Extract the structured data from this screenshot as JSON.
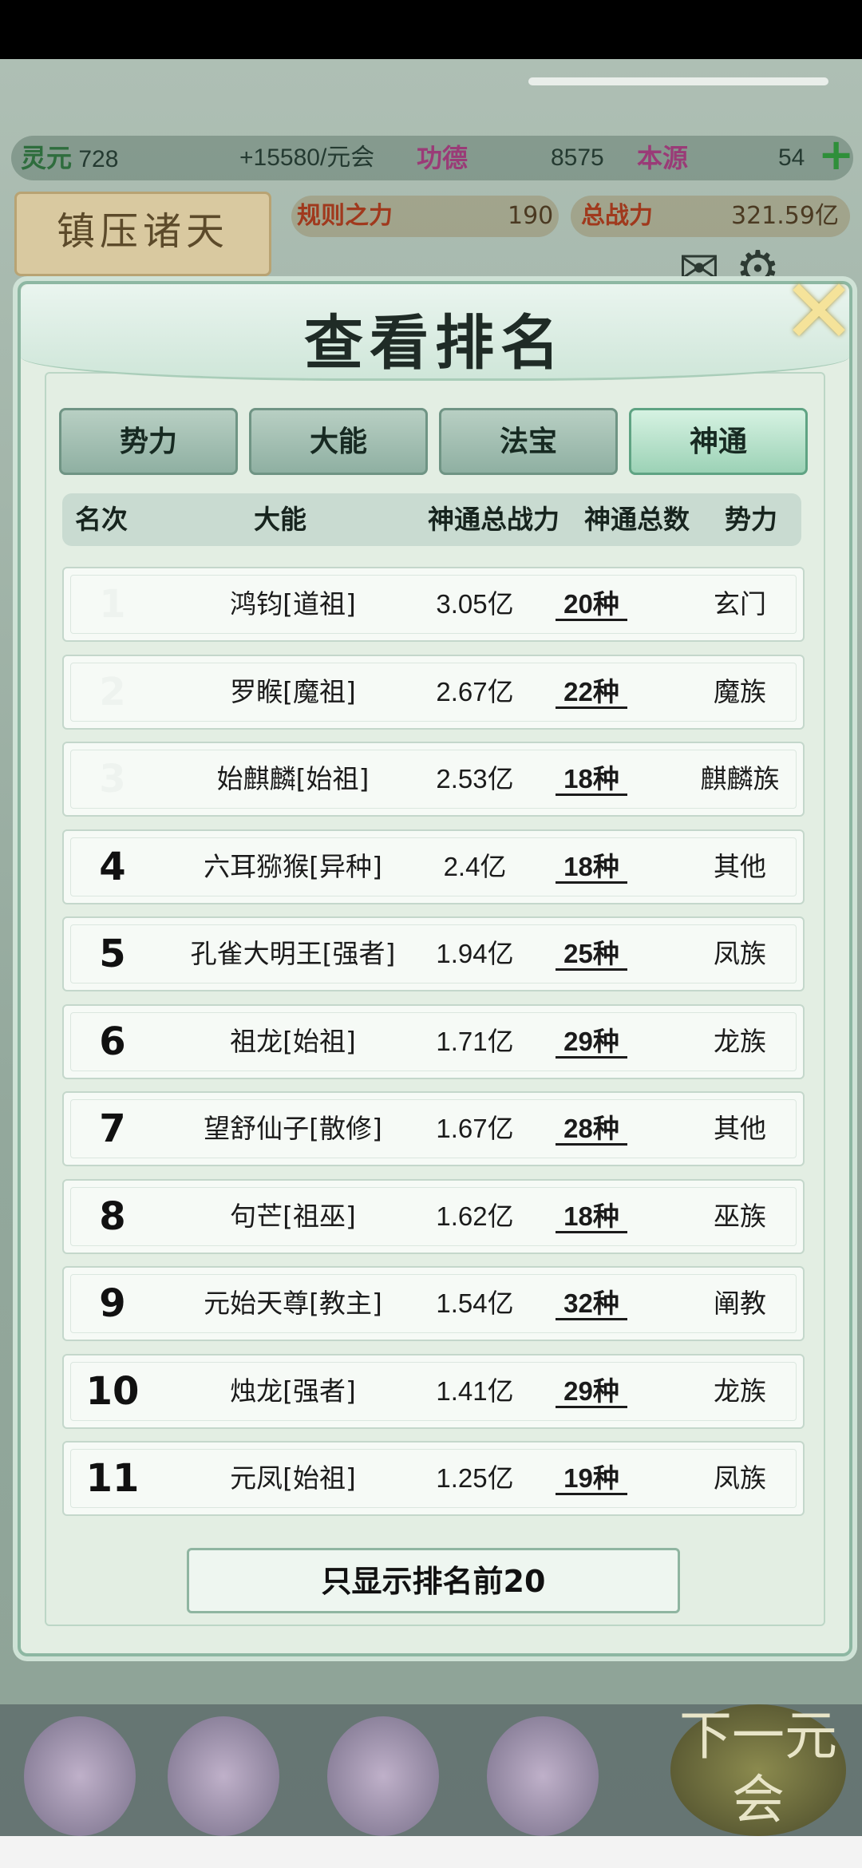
{
  "resources": {
    "lingyuan_label": "灵元",
    "lingyuan_value": "728",
    "lingyuan_rate": "+15580/元会",
    "gongde_label": "功德",
    "gongde_value": "8575",
    "benyuan_label": "本源",
    "benyuan_value": "54",
    "guize_label": "规则之力",
    "guize_value": "190",
    "zongzhan_label": "总战力",
    "zongzhan_value": "321.59亿",
    "zhenya_label": "镇压诸天"
  },
  "modal": {
    "title": "查看排名",
    "close": "✕",
    "tabs": [
      "势力",
      "大能",
      "法宝",
      "神通"
    ],
    "active_tab": "神通",
    "columns": {
      "rank": "名次",
      "name": "大能",
      "power": "神通总战力",
      "count": "神通总数",
      "faction": "势力"
    },
    "rows": [
      {
        "rank": "1",
        "name": "鸿钧[道祖]",
        "power": "3.05亿",
        "count": "20种",
        "faction": "玄门"
      },
      {
        "rank": "2",
        "name": "罗睺[魔祖]",
        "power": "2.67亿",
        "count": "22种",
        "faction": "魔族"
      },
      {
        "rank": "3",
        "name": "始麒麟[始祖]",
        "power": "2.53亿",
        "count": "18种",
        "faction": "麒麟族"
      },
      {
        "rank": "4",
        "name": "六耳猕猴[异种]",
        "power": "2.4亿",
        "count": "18种",
        "faction": "其他"
      },
      {
        "rank": "5",
        "name": "孔雀大明王[强者]",
        "power": "1.94亿",
        "count": "25种",
        "faction": "凤族"
      },
      {
        "rank": "6",
        "name": "祖龙[始祖]",
        "power": "1.71亿",
        "count": "29种",
        "faction": "龙族"
      },
      {
        "rank": "7",
        "name": "望舒仙子[散修]",
        "power": "1.67亿",
        "count": "28种",
        "faction": "其他"
      },
      {
        "rank": "8",
        "name": "句芒[祖巫]",
        "power": "1.62亿",
        "count": "18种",
        "faction": "巫族"
      },
      {
        "rank": "9",
        "name": "元始天尊[教主]",
        "power": "1.54亿",
        "count": "32种",
        "faction": "阐教"
      },
      {
        "rank": "10",
        "name": "烛龙[强者]",
        "power": "1.41亿",
        "count": "29种",
        "faction": "龙族"
      },
      {
        "rank": "11",
        "name": "元凤[始祖]",
        "power": "1.25亿",
        "count": "19种",
        "faction": "凤族"
      }
    ],
    "footer_button": "只显示排名前20"
  },
  "bottom": {
    "next_label": "下一元会"
  }
}
